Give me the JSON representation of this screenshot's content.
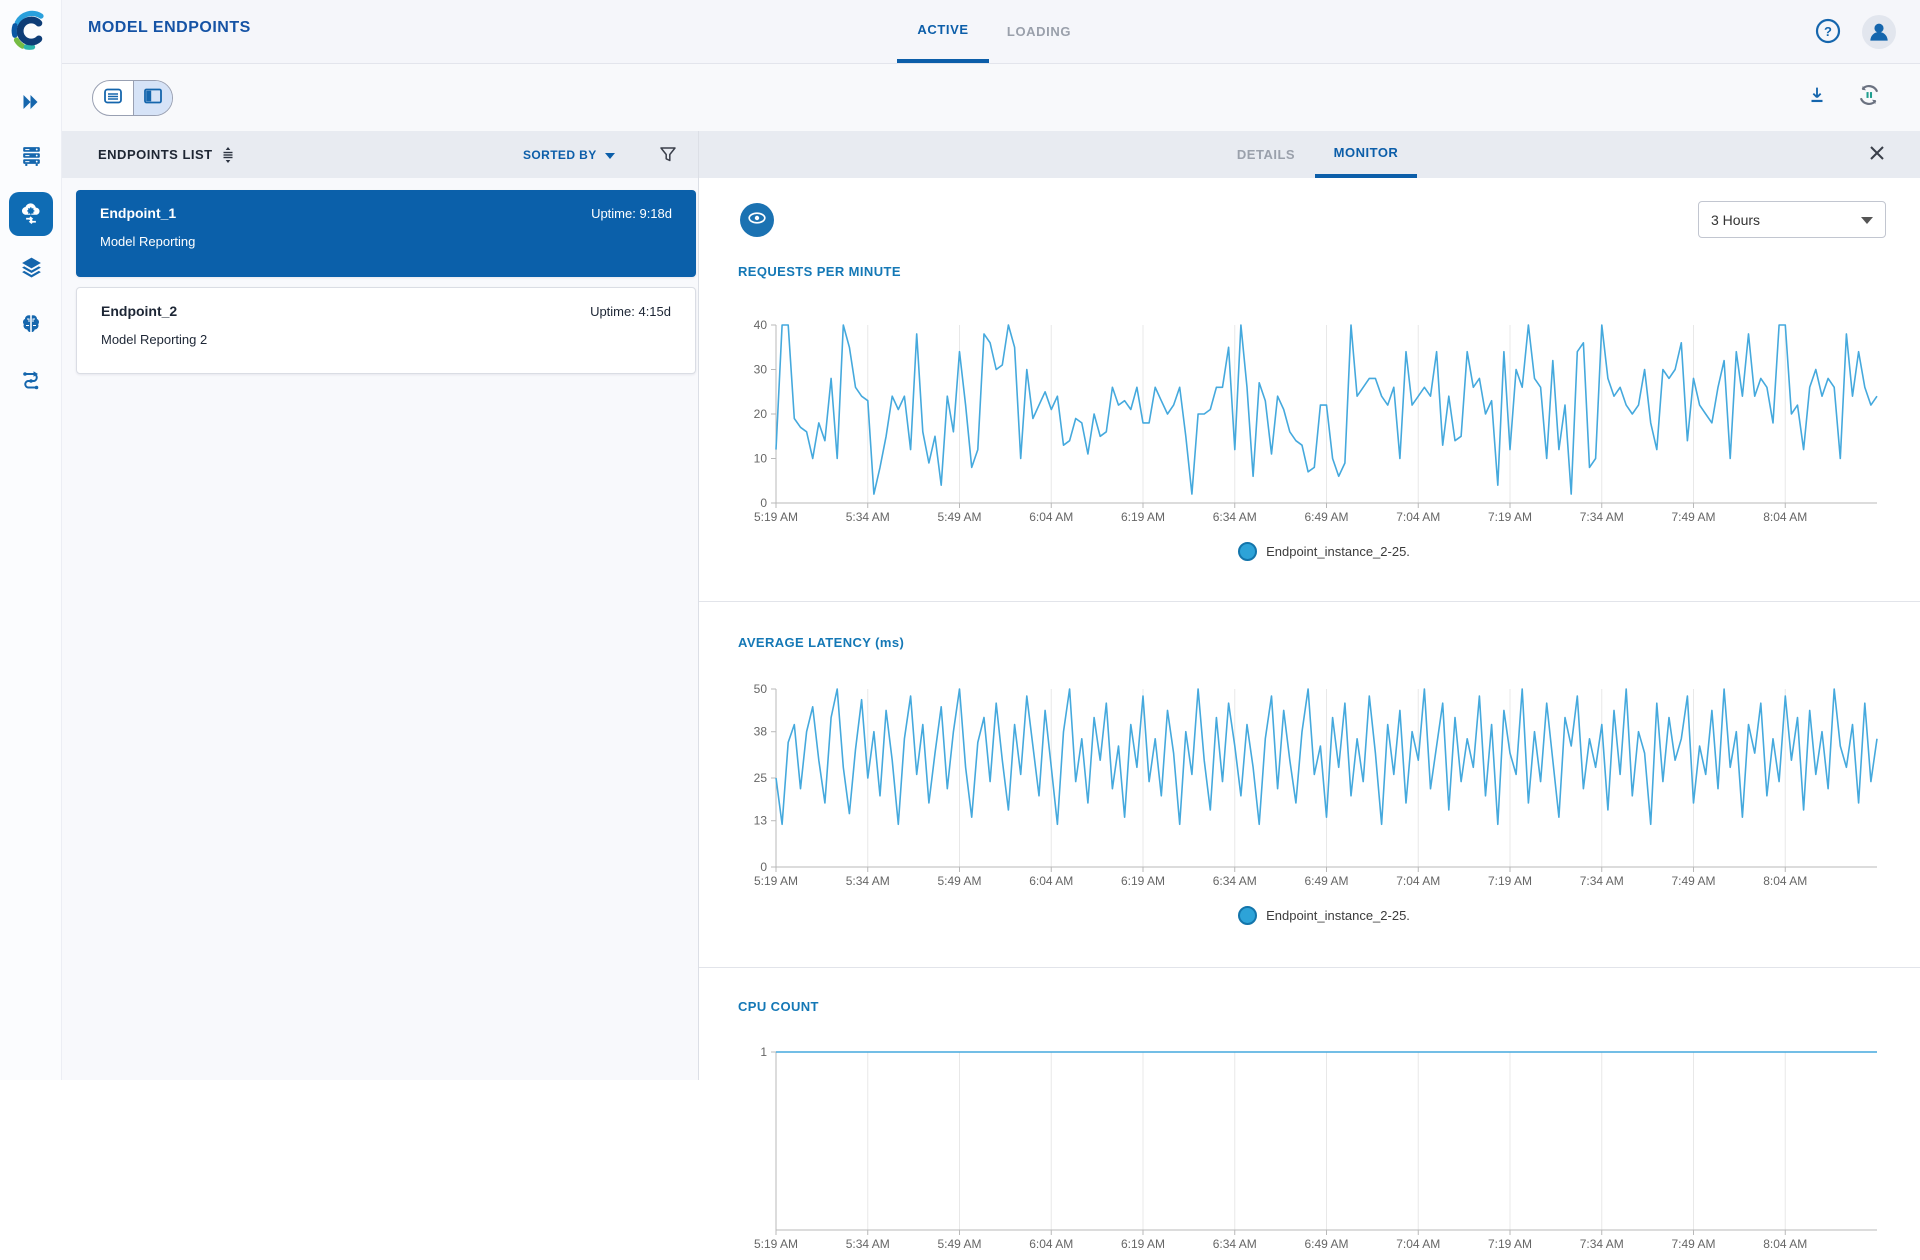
{
  "header": {
    "title": "MODEL ENDPOINTS",
    "tabs": [
      {
        "label": "ACTIVE",
        "active": true
      },
      {
        "label": "LOADING",
        "active": false
      }
    ]
  },
  "sidebar": {
    "icons": [
      "expand-double-chevron-icon",
      "server-rack-icon",
      "model-endpoints-cloud-gear-icon",
      "layers-icon",
      "brain-icon",
      "workflow-icon"
    ],
    "selected_icon": "model-endpoints-cloud-gear-icon"
  },
  "toolbar": {
    "view_toggle": [
      "table-view",
      "split-view"
    ],
    "selected_view": "split-view",
    "right_icons": [
      "download-icon",
      "auto-refresh-pause-icon"
    ]
  },
  "endpoints_panel": {
    "title": "ENDPOINTS LIST",
    "sorted_by_label": "SORTED BY",
    "endpoints": [
      {
        "name": "Endpoint_1",
        "uptime": "Uptime: 9:18d",
        "description": "Model Reporting",
        "selected": true
      },
      {
        "name": "Endpoint_2",
        "uptime": "Uptime: 4:15d",
        "description": "Model Reporting 2",
        "selected": false
      }
    ]
  },
  "monitor_panel": {
    "tabs": [
      {
        "label": "DETAILS",
        "active": false
      },
      {
        "label": "MONITOR",
        "active": true
      }
    ],
    "time_range_value": "3 Hours"
  },
  "colors": {
    "brand_blue": "#1553a5",
    "tab_active_blue": "#0c5ea9",
    "selected_card_blue": "#0b60aa",
    "chart_title_blue": "#1478b6",
    "line_blue": "#45a9dd",
    "legend_dot_fill": "#2da3d8",
    "legend_dot_border": "#1375ab",
    "band_gray": "#e8ebf1",
    "sidebar_selected_bg": "#0f6cb4"
  },
  "chart_data": [
    {
      "type": "line",
      "title": "REQUESTS PER MINUTE",
      "legend": "Endpoint_instance_2-25.",
      "line_color": "#45a9dd",
      "ylim": [
        0,
        40
      ],
      "yticks": [
        0,
        10,
        20,
        30,
        40
      ],
      "tick_step": 15,
      "x_tick_labels": [
        "5:19 AM",
        "5:34 AM",
        "5:49 AM",
        "6:04 AM",
        "6:19 AM",
        "6:34 AM",
        "6:49 AM",
        "7:04 AM",
        "7:19 AM",
        "7:34 AM",
        "7:49 AM",
        "8:04 AM"
      ],
      "values": [
        12,
        40,
        40,
        19,
        17,
        16,
        10,
        18,
        14,
        28,
        10,
        40,
        35,
        26,
        24,
        23,
        2,
        8,
        15,
        24,
        21,
        24,
        12,
        38,
        16,
        9,
        15,
        4,
        24,
        16,
        34,
        22,
        8,
        12,
        38,
        36,
        30,
        31,
        40,
        35,
        10,
        30,
        19,
        22,
        25,
        21,
        24,
        13,
        14,
        19,
        18,
        11,
        20,
        15,
        16,
        26,
        22,
        23,
        21,
        26,
        18,
        18,
        26,
        23,
        20,
        22,
        26,
        15,
        2,
        20,
        20,
        21,
        26,
        26,
        35,
        12,
        40,
        26,
        6,
        27,
        23,
        11,
        24,
        21,
        16,
        14,
        13,
        7,
        8,
        22,
        22,
        10,
        6,
        9,
        40,
        24,
        26,
        28,
        28,
        24,
        22,
        26,
        10,
        34,
        22,
        24,
        26,
        24,
        34,
        13,
        24,
        14,
        15,
        34,
        26,
        28,
        20,
        23,
        4,
        34,
        12,
        30,
        26,
        40,
        28,
        26,
        10,
        32,
        12,
        22,
        2,
        34,
        36,
        8,
        10,
        40,
        28,
        24,
        26,
        22,
        20,
        22,
        30,
        18,
        12,
        30,
        28,
        30,
        36,
        14,
        28,
        22,
        20,
        18,
        26,
        32,
        10,
        34,
        24,
        38,
        24,
        28,
        26,
        18,
        40,
        40,
        20,
        22,
        12,
        26,
        30,
        24,
        28,
        26,
        10,
        38,
        24,
        34,
        26,
        22,
        24
      ]
    },
    {
      "type": "line",
      "title": "AVERAGE LATENCY (ms)",
      "legend": "Endpoint_instance_2-25.",
      "line_color": "#45a9dd",
      "ylim": [
        0,
        50
      ],
      "yticks": [
        0,
        13,
        25,
        38,
        50
      ],
      "tick_step": 15,
      "x_tick_labels": [
        "5:19 AM",
        "5:34 AM",
        "5:49 AM",
        "6:04 AM",
        "6:19 AM",
        "6:34 AM",
        "6:49 AM",
        "7:04 AM",
        "7:19 AM",
        "7:34 AM",
        "7:49 AM",
        "8:04 AM"
      ],
      "values": [
        25,
        12,
        35,
        40,
        22,
        38,
        45,
        30,
        18,
        42,
        50,
        28,
        15,
        33,
        47,
        25,
        38,
        20,
        44,
        30,
        12,
        36,
        48,
        26,
        40,
        18,
        32,
        45,
        22,
        38,
        50,
        28,
        14,
        35,
        42,
        24,
        46,
        30,
        16,
        40,
        26,
        48,
        34,
        20,
        44,
        28,
        12,
        38,
        50,
        24,
        36,
        18,
        42,
        30,
        46,
        22,
        34,
        14,
        40,
        28,
        48,
        24,
        36,
        20,
        44,
        32,
        12,
        38,
        26,
        50,
        30,
        16,
        42,
        24,
        46,
        34,
        20,
        40,
        28,
        12,
        36,
        48,
        22,
        44,
        30,
        18,
        38,
        50,
        26,
        34,
        14,
        42,
        28,
        46,
        20,
        36,
        24,
        48,
        32,
        12,
        40,
        26,
        44,
        18,
        38,
        30,
        50,
        22,
        34,
        46,
        16,
        42,
        24,
        36,
        28,
        48,
        20,
        40,
        12,
        44,
        32,
        26,
        50,
        18,
        38,
        24,
        46,
        30,
        14,
        42,
        34,
        48,
        22,
        36,
        28,
        40,
        16,
        44,
        26,
        50,
        20,
        38,
        32,
        12,
        46,
        24,
        42,
        30,
        36,
        48,
        18,
        34,
        26,
        44,
        22,
        50,
        28,
        38,
        14,
        40,
        32,
        46,
        20,
        36,
        24,
        48,
        30,
        42,
        16,
        44,
        26,
        38,
        22,
        50,
        34,
        28,
        40,
        18,
        46,
        24,
        36
      ]
    },
    {
      "type": "line",
      "title": "CPU COUNT",
      "line_color": "#45a9dd",
      "ylim": [
        0,
        1
      ],
      "yticks": [
        1
      ],
      "tick_step": 15,
      "points": 181,
      "constant": 1,
      "x_tick_labels": [
        "5:19 AM",
        "5:34 AM",
        "5:49 AM",
        "6:04 AM",
        "6:19 AM",
        "6:34 AM",
        "6:49 AM",
        "7:04 AM",
        "7:19 AM",
        "7:34 AM",
        "7:49 AM",
        "8:04 AM"
      ]
    }
  ]
}
